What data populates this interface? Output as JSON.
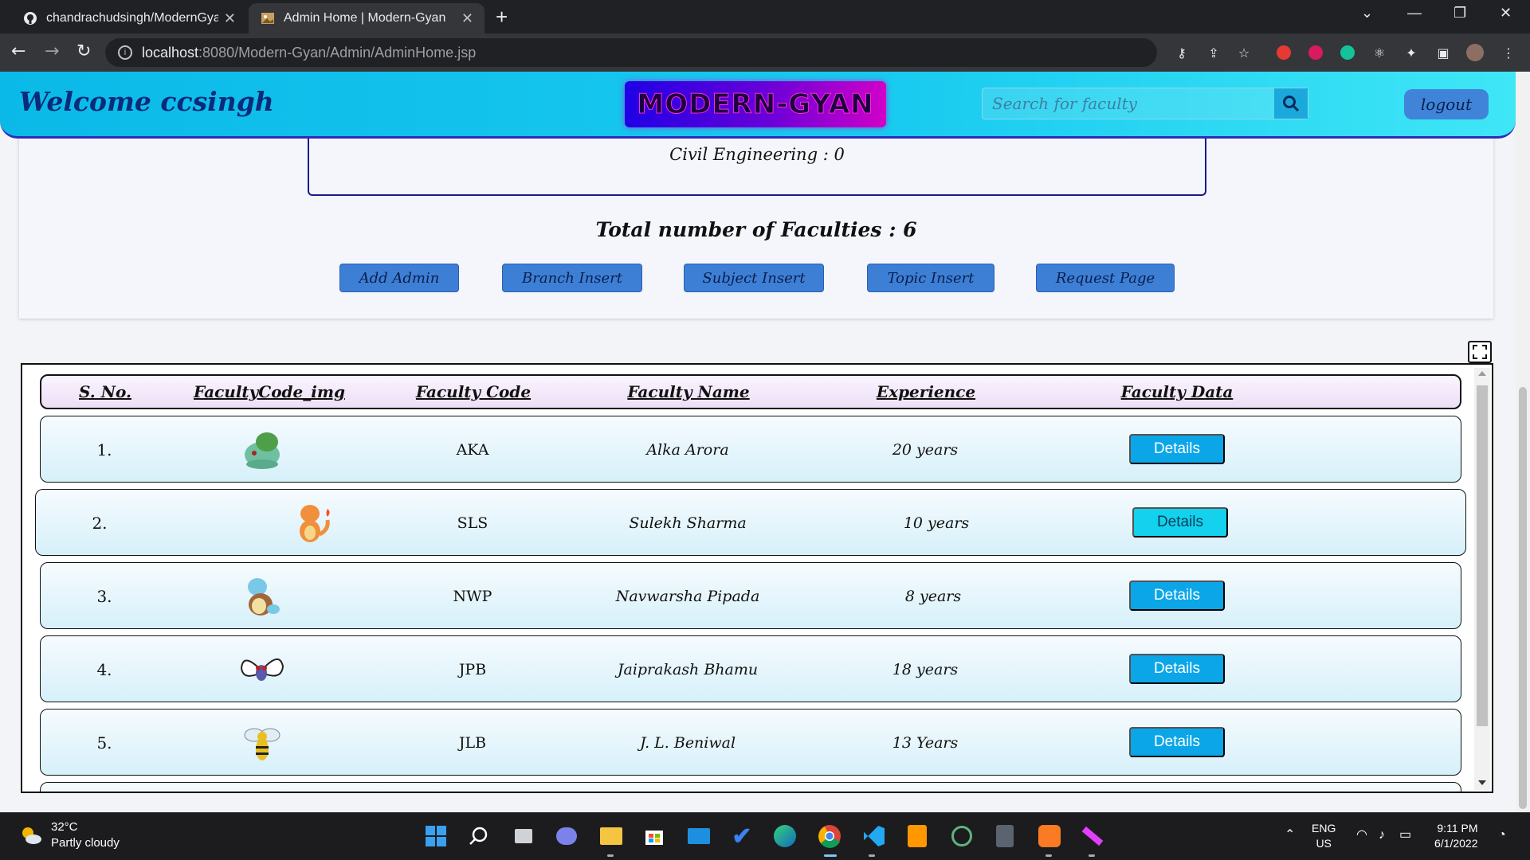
{
  "browser": {
    "tabs": [
      {
        "title": "chandrachudsingh/ModernGyan",
        "active": false
      },
      {
        "title": "Admin Home | Modern-Gyan",
        "active": true
      }
    ],
    "url_host": "localhost",
    "url_path": ":8080/Modern-Gyan/Admin/AdminHome.jsp"
  },
  "header": {
    "welcome": "Welcome ccsingh",
    "logo": "Modern-Gyan",
    "search_placeholder": "Search for faculty",
    "logout_label": "logout"
  },
  "summary": {
    "branch_line": "Civil Engineering : 0",
    "total": "Total number of Faculties : 6",
    "buttons": [
      "Add Admin",
      "Branch Insert",
      "Subject Insert",
      "Topic Insert",
      "Request Page"
    ]
  },
  "table": {
    "headers": [
      "S. No.",
      "FacultyCode_img",
      "Faculty Code",
      "Faculty Name",
      "Experience",
      "Faculty Data"
    ],
    "rows": [
      {
        "sno": "1.",
        "image": "bulbasaur-icon",
        "code": "AKA",
        "name": "Alka Arora",
        "experience": "20 years",
        "action": "Details"
      },
      {
        "sno": "2.",
        "image": "charmander-icon",
        "code": "SLS",
        "name": "Sulekh Sharma",
        "experience": "10 years",
        "action": "Details"
      },
      {
        "sno": "3.",
        "image": "squirtle-icon",
        "code": "NWP",
        "name": "Navwarsha Pipada",
        "experience": "8 years",
        "action": "Details"
      },
      {
        "sno": "4.",
        "image": "butterfree-icon",
        "code": "JPB",
        "name": "Jaiprakash Bhamu",
        "experience": "18 years",
        "action": "Details"
      },
      {
        "sno": "5.",
        "image": "beedrill-icon",
        "code": "JLB",
        "name": "J. L. Beniwal",
        "experience": "13 Years",
        "action": "Details"
      }
    ]
  },
  "taskbar": {
    "weather_temp": "32°C",
    "weather_desc": "Partly cloudy",
    "lang_top": "ENG",
    "lang_bottom": "US",
    "time": "9:11 PM",
    "date": "6/1/2022"
  },
  "colors": {
    "header_gradient_start": "#0bb9e8",
    "header_gradient_end": "#3fe6f6",
    "action_button": "#3e7fd6",
    "details_button": "#0aa6e8"
  }
}
